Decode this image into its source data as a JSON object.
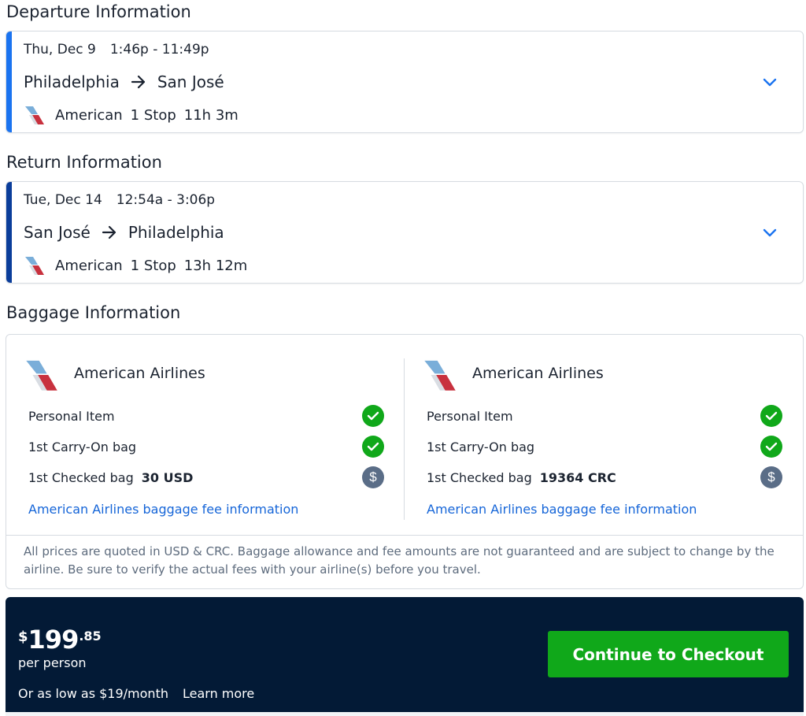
{
  "departure": {
    "section_title": "Departure Information",
    "date": "Thu, Dec 9",
    "time": "1:46p - 11:49p",
    "origin": "Philadelphia",
    "destination": "San José",
    "airline": "American",
    "stops": "1 Stop",
    "duration": "11h 3m",
    "accent_color": "#1a73f0"
  },
  "return": {
    "section_title": "Return Information",
    "date": "Tue, Dec 14",
    "time": "12:54a - 3:06p",
    "origin": "San José",
    "destination": "Philadelphia",
    "airline": "American",
    "stops": "1 Stop",
    "duration": "13h 12m",
    "accent_color": "#0a3d9a"
  },
  "baggage": {
    "section_title": "Baggage Information",
    "columns": [
      {
        "airline_name": "American Airlines",
        "personal_item": "Personal Item",
        "carry_on": "1st Carry-On bag",
        "checked": "1st Checked bag",
        "checked_fee": "30 USD",
        "link": "American Airlines baggage fee information"
      },
      {
        "airline_name": "American Airlines",
        "personal_item": "Personal Item",
        "carry_on": "1st Carry-On bag",
        "checked": "1st Checked bag",
        "checked_fee": "19364 CRC",
        "link": "American Airlines baggage fee information"
      }
    ],
    "disclaimer": "All prices are quoted in USD & CRC. Baggage allowance and fee amounts are not guaranteed and are subject to change by the airline. Be sure to verify the actual fees with your airline(s) before you travel."
  },
  "checkout": {
    "currency_symbol": "$",
    "price_whole": "199",
    "price_cents": ".85",
    "per_person": "per person",
    "afford_text": "Or as low as $19/month",
    "learn_more": "Learn more",
    "button_label": "Continue to Checkout",
    "button_color": "#10a81a",
    "bar_color": "#031a36"
  },
  "icons": {
    "airline_logo": "american-airlines-logo",
    "route_arrow": "arrow-right-icon",
    "expand": "chevron-down-icon",
    "included": "check-circle-icon",
    "fee": "dollar-circle-icon"
  }
}
